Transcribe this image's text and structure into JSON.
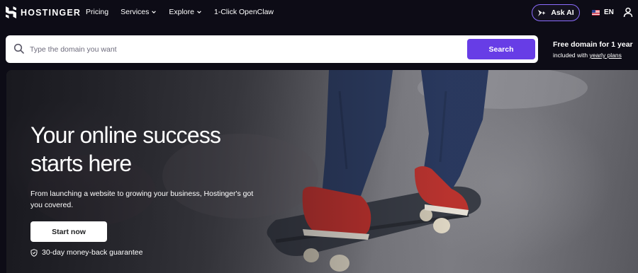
{
  "nav": {
    "brand": "HOSTINGER",
    "links": [
      {
        "label": "Pricing",
        "has_dropdown": false
      },
      {
        "label": "Services",
        "has_dropdown": true
      },
      {
        "label": "Explore",
        "has_dropdown": true
      },
      {
        "label": "1-Click OpenClaw",
        "has_dropdown": false
      }
    ],
    "ask_ai_label": "Ask AI",
    "language": "EN"
  },
  "search": {
    "placeholder": "Type the domain you want",
    "value": "",
    "button_label": "Search"
  },
  "promo": {
    "title": "Free domain for 1 year",
    "subtitle_prefix": "included with ",
    "subtitle_link": "yearly plans"
  },
  "hero": {
    "title_line1": "Your online success",
    "title_line2": "starts here",
    "subtitle": "From launching a website to growing your business, Hostinger's got you covered.",
    "cta_label": "Start now",
    "guarantee": "30-day money-back guarantee"
  },
  "colors": {
    "background": "#0d0c16",
    "accent": "#673de6",
    "ask_ai_border": "#8c6dff"
  },
  "icons": [
    "hostinger-logo-icon",
    "chevron-down-icon",
    "ask-ai-sparkle-icon",
    "us-flag-icon",
    "user-icon",
    "search-icon",
    "shield-check-icon"
  ]
}
